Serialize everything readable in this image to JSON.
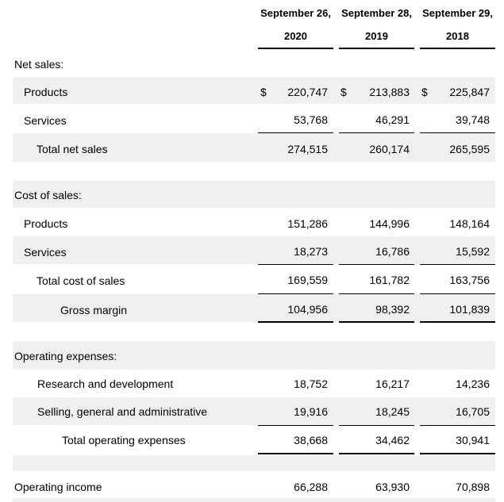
{
  "headers": [
    {
      "line1": "September 26,",
      "line2": "2020"
    },
    {
      "line1": "September 28,",
      "line2": "2019"
    },
    {
      "line1": "September 29,",
      "line2": "2018"
    }
  ],
  "currency_symbol": "$",
  "sections": {
    "net_sales": {
      "title": "Net sales:",
      "products": {
        "label": "Products",
        "values": [
          "220,747",
          "213,883",
          "225,847"
        ]
      },
      "services": {
        "label": "Services",
        "values": [
          "53,768",
          "46,291",
          "39,748"
        ]
      },
      "total": {
        "label": "Total net sales",
        "values": [
          "274,515",
          "260,174",
          "265,595"
        ]
      }
    },
    "cost_of_sales": {
      "title": "Cost of sales:",
      "products": {
        "label": "Products",
        "values": [
          "151,286",
          "144,996",
          "148,164"
        ]
      },
      "services": {
        "label": "Services",
        "values": [
          "18,273",
          "16,786",
          "15,592"
        ]
      },
      "total": {
        "label": "Total cost of sales",
        "values": [
          "169,559",
          "161,782",
          "163,756"
        ]
      },
      "gross_margin": {
        "label": "Gross margin",
        "values": [
          "104,956",
          "98,392",
          "101,839"
        ]
      }
    },
    "operating_expenses": {
      "title": "Operating expenses:",
      "rd": {
        "label": "Research and development",
        "values": [
          "18,752",
          "16,217",
          "14,236"
        ]
      },
      "sga": {
        "label": "Selling, general and administrative",
        "values": [
          "19,916",
          "18,245",
          "16,705"
        ]
      },
      "total": {
        "label": "Total operating expenses",
        "values": [
          "38,668",
          "34,462",
          "30,941"
        ]
      }
    },
    "operating_income": {
      "label": "Operating income",
      "values": [
        "66,288",
        "63,930",
        "70,898"
      ]
    }
  }
}
